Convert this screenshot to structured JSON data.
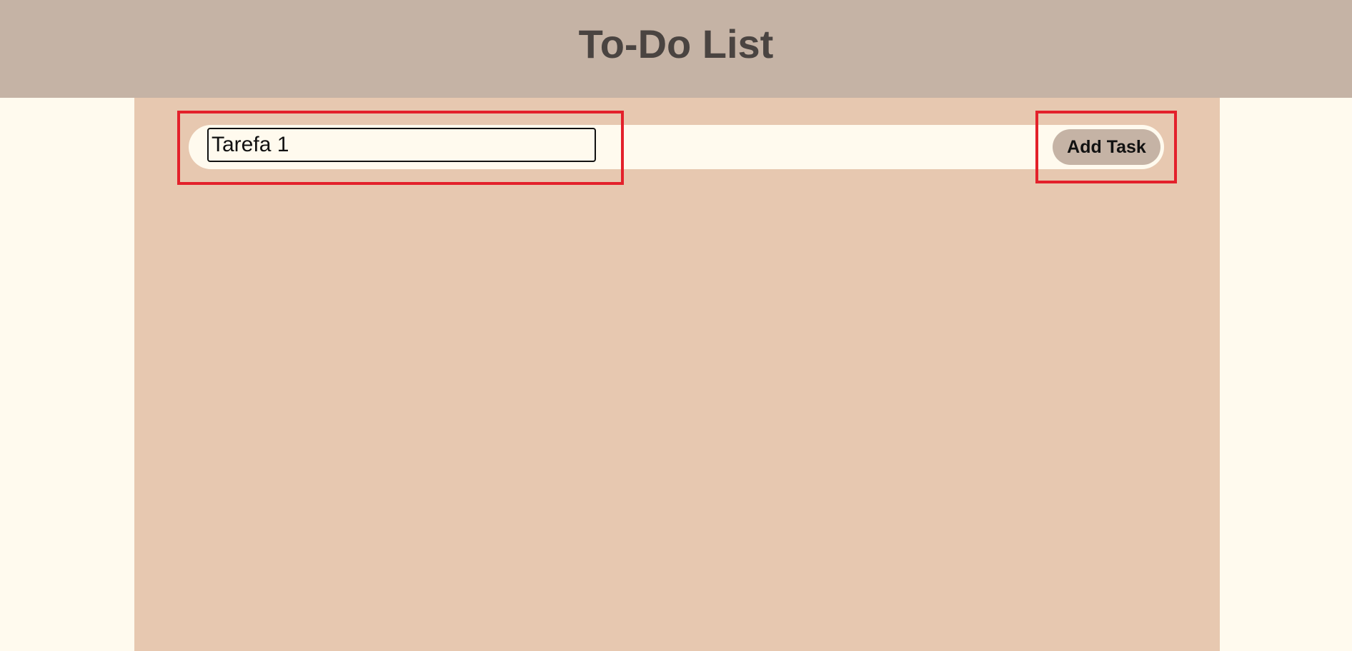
{
  "app": {
    "title": "To-Do List"
  },
  "form": {
    "input_value": "Tarefa 1",
    "add_button_label": "Add Task"
  },
  "tasks": [],
  "colors": {
    "header_bg": "#c5b3a5",
    "page_bg": "#fffaee",
    "main_bg": "#e7c8b0",
    "button_bg": "#c5b3a5",
    "highlight": "#e3212b",
    "title_text": "#4a4441"
  }
}
